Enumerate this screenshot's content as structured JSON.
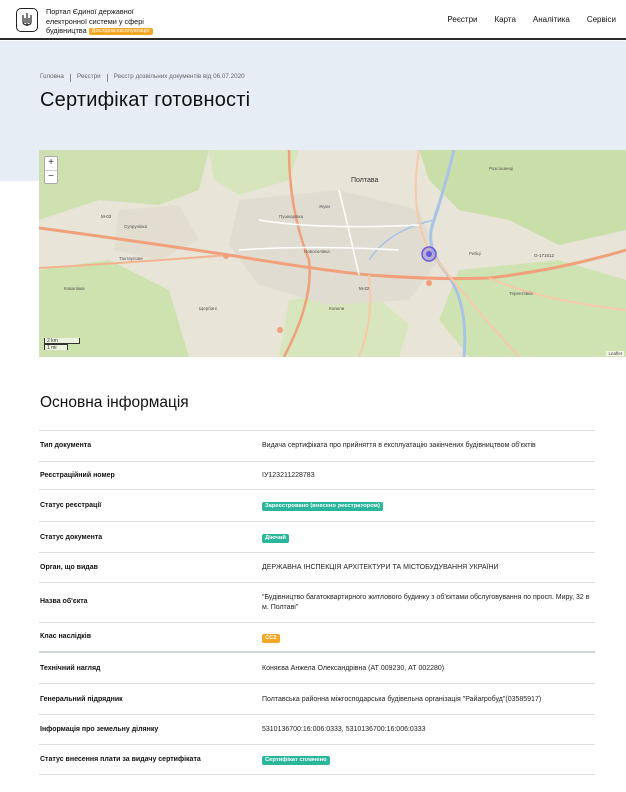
{
  "header": {
    "brand_line1": "Портал Єдиної державної",
    "brand_line2": "електронної системи у сфері",
    "brand_line3": "будівництва",
    "beta_badge": "Дослідна експлуатація",
    "beta_color": "#f5a623",
    "logo_icon": "trident-icon",
    "nav": [
      "Реєстри",
      "Карта",
      "Аналітика",
      "Сервіси"
    ]
  },
  "breadcrumb": [
    "Головна",
    "Реєстри",
    "Реєстр дозвільних документів від 06.07.2020"
  ],
  "page_title": "Сертифікат готовності",
  "map": {
    "zoom_in": "+",
    "zoom_out": "−",
    "scale_km": "2 km",
    "scale_mi": "1 mi",
    "attribution": "Leaflet",
    "labels": [
      "Полтава",
      "Рибці",
      "Розсошенці",
      "Терентіївка",
      "Тахтаулове",
      "Кременчуцька",
      "Ковалівка",
      "Супрунівка",
      "Пушкарівка",
      "Щербані",
      "Жуки",
      "Копили",
      "Новоселівка"
    ],
    "road_labels": [
      "M-03",
      "M-22",
      "O-171612"
    ],
    "marker_color": "#6a5bd6"
  },
  "section_title": "Основна інформація",
  "rows": [
    {
      "label": "Тип документа",
      "value": "Видача сертифіката про прийняття в експлуатацію закінчених будівництвом об'єктів"
    },
    {
      "label": "Реєстраційний номер",
      "value": "ІУ123211228783"
    },
    {
      "label": "Статус реєстрації",
      "badge": "Зареєстровано (внесено реєстратором)",
      "badge_color": "#2bb59a"
    },
    {
      "label": "Статус документа",
      "badge": "Діючий",
      "badge_color": "#2bb59a"
    },
    {
      "label": "Орган, що видав",
      "value": "ДЕРЖАВНА ІНСПЕКЦІЯ АРХІТЕКТУРИ ТА МІСТОБУДУВАННЯ УКРАЇНИ"
    },
    {
      "label": "Назва об'єкта",
      "value": "\"Будівництво багатоквартирного житлового будинку з об'єктами обслуговування по просп. Миру, 32 в м. Полтаві\""
    },
    {
      "label": "Клас наслідків",
      "badge": "СС2",
      "badge_color": "#f5a623"
    },
    {
      "label": "Технічний нагляд",
      "value": "Коняєва Анжела Олександрівна (АТ 009230, АТ 002280)"
    },
    {
      "label": "Генеральний підрядник",
      "value": "Полтавська районна міжгосподарська будівельна організація \"Райагробуд\"(03585917)"
    },
    {
      "label": "Інформація про земельну ділянку",
      "value": "5310136700:16:006:0333, 5310136700:16:006:0333"
    },
    {
      "label": "Статус внесення плати за видачу сертифіката",
      "badge": "Сертифікат сплачено",
      "badge_color": "#2bb59a"
    }
  ]
}
